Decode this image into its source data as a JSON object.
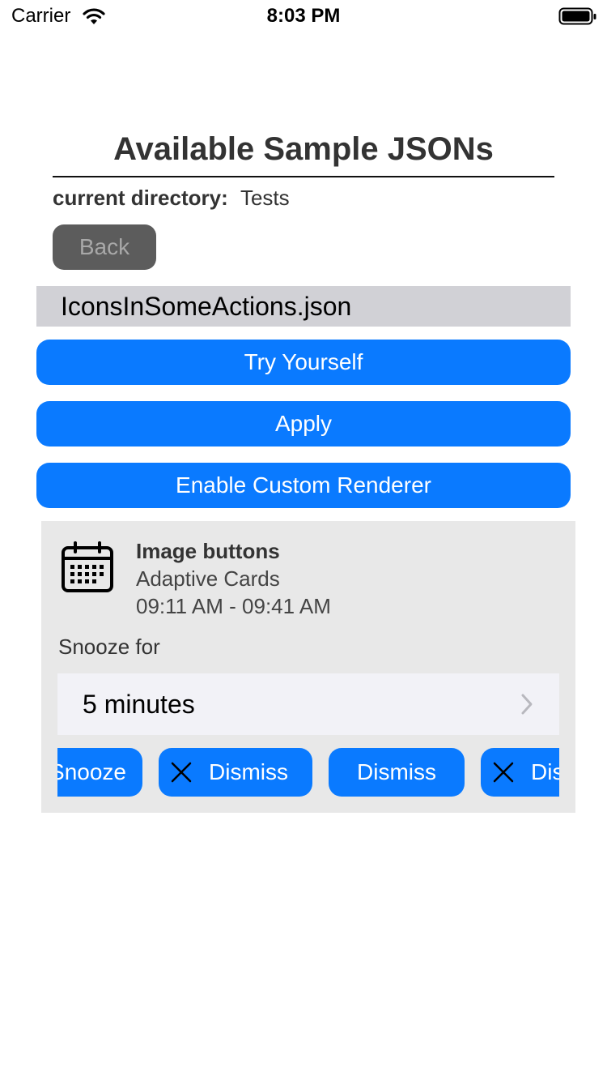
{
  "status_bar": {
    "carrier": "Carrier",
    "time": "8:03 PM",
    "wifi_icon": "wifi-icon",
    "battery_icon": "battery-icon"
  },
  "header": {
    "title": "Available Sample JSONs",
    "directory_label": "current directory:",
    "directory_value": "Tests",
    "back_label": "Back"
  },
  "file_row": {
    "name": "IconsInSomeActions.json"
  },
  "buttons": {
    "try_yourself": "Try Yourself",
    "apply": "Apply",
    "custom_renderer": "Enable Custom Renderer"
  },
  "card": {
    "icon": "calendar-icon",
    "title": "Image buttons",
    "subtitle": "Adaptive Cards",
    "time": "09:11 AM - 09:41 AM",
    "snooze_label": "Snooze for",
    "picker_value": "5 minutes",
    "actions": [
      {
        "label": "Snooze",
        "icon": ""
      },
      {
        "label": "Dismiss",
        "icon": "close-icon"
      },
      {
        "label": "Dismiss",
        "icon": ""
      },
      {
        "label": "Dismiss",
        "icon": "close-icon"
      }
    ]
  },
  "colors": {
    "accent": "#0a7aff",
    "back_button": "#5c5c5c",
    "file_row": "#d1d1d6",
    "card_bg": "#e8e8e8",
    "picker_bg": "#f2f2f7"
  }
}
